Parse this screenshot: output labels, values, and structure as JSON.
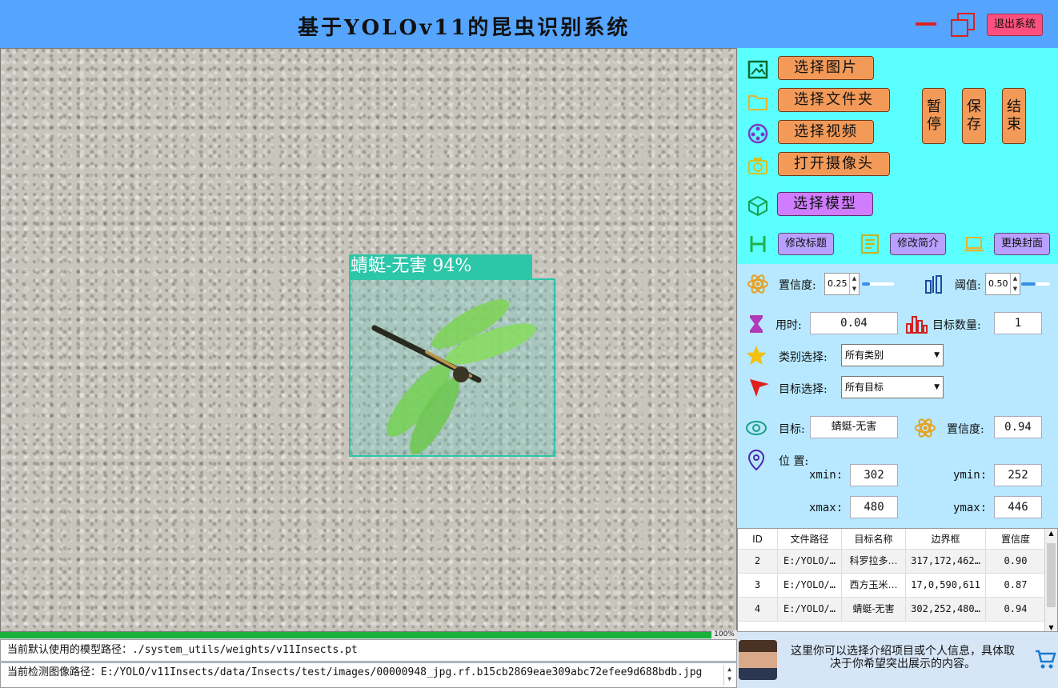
{
  "titlebar": {
    "title": "基于YOLOv11的昆虫识别系统",
    "exit_label": "退出系统"
  },
  "detection": {
    "label": "蜻蜓-无害  94%"
  },
  "progress": {
    "percent": 100,
    "text": "100%"
  },
  "status": {
    "model_path": "当前默认使用的模型路径：./system_utils/weights/v11Insects.pt",
    "image_path": "当前检测图像路径：E:/YOLO/v11Insects/data/Insects/test/images/00000948_jpg.rf.b15cb2869eae309abc72efee9d688bdb.jpg"
  },
  "buttons": {
    "select_image": "选择图片",
    "select_folder": "选择文件夹",
    "select_video": "选择视频",
    "open_camera": "打开摄像头",
    "select_model": "选择模型",
    "pause": "暂停",
    "save": "保存",
    "end": "结束",
    "edit_title": "修改标题",
    "edit_intro": "修改简介",
    "change_cover": "更换封面"
  },
  "settings": {
    "confidence_label": "置信度:",
    "confidence_value": "0.25",
    "confidence_fraction": 0.25,
    "iou_label": "阈值:",
    "iou_value": "0.50",
    "iou_fraction": 0.5
  },
  "stats": {
    "time_label": "用时:",
    "time_value": "0.04",
    "count_label": "目标数量:",
    "count_value": "1",
    "class_select_label": "类别选择:",
    "class_select_value": "所有类别",
    "target_select_label": "目标选择:",
    "target_select_value": "所有目标"
  },
  "target": {
    "name_label": "目标:",
    "name_value": "蜻蜓-无害",
    "conf_label": "置信度:",
    "conf_value": "0.94",
    "position_label": "位  置:",
    "xmin_label": "xmin:",
    "xmin": "302",
    "ymin_label": "ymin:",
    "ymin": "252",
    "xmax_label": "xmax:",
    "xmax": "480",
    "ymax_label": "ymax:",
    "ymax": "446"
  },
  "table": {
    "headers": [
      "ID",
      "文件路径",
      "目标名称",
      "边界框",
      "置信度"
    ],
    "rows": [
      [
        "2",
        "E:/YOLO/…",
        "科罗拉多…",
        "317,172,462…",
        "0.90"
      ],
      [
        "3",
        "E:/YOLO/…",
        "西方玉米…",
        "17,0,590,611",
        "0.87"
      ],
      [
        "4",
        "E:/YOLO/…",
        "蜻蜓-无害",
        "302,252,480…",
        "0.94"
      ]
    ]
  },
  "footer": {
    "intro": "这里你可以选择介绍项目或个人信息，具体取决于你希望突出展示的内容。"
  },
  "icons": {
    "image": "image-icon",
    "folder": "folder-icon",
    "video": "video-reel-icon",
    "camera": "camera-icon",
    "model": "cube-icon",
    "heading": "heading-icon",
    "intro": "document-icon",
    "cover": "laptop-icon",
    "atom": "atom-icon",
    "threshold": "threshold-icon",
    "hourglass": "hourglass-icon",
    "bars": "bar-chart-icon",
    "star": "star-icon",
    "pointer": "pointer-icon",
    "eye": "eye-icon",
    "location": "location-icon",
    "cart": "cart-icon"
  },
  "colors": {
    "titlebar": "#55a5ff",
    "panel_top": "#5afffe",
    "panel_mid": "#b8e8ff",
    "orange_button": "#f39a59",
    "purple_button": "#cf7cff",
    "detection": "#2cc6a8",
    "progress": "#1ab03c"
  }
}
